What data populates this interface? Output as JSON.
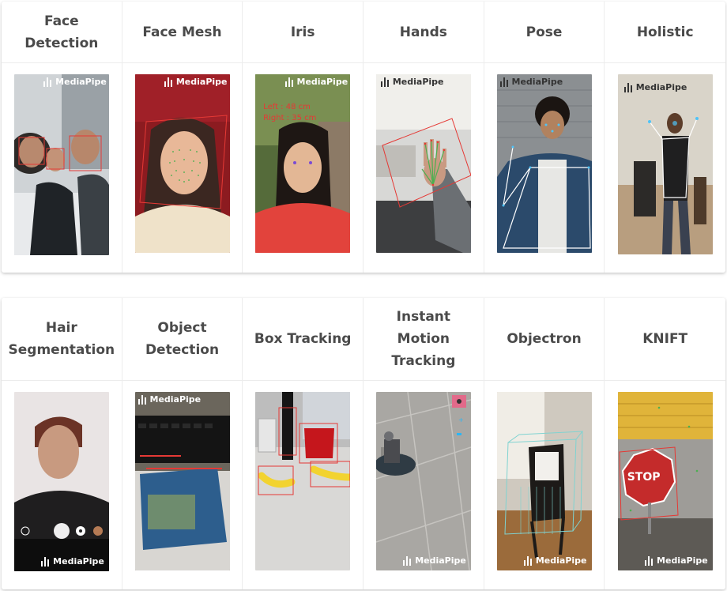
{
  "rows": [
    {
      "items": [
        {
          "key": "face_detection",
          "line1": "Face",
          "line2": "Detection"
        },
        {
          "key": "face_mesh",
          "line1": "Face Mesh",
          "line2": ""
        },
        {
          "key": "iris",
          "line1": "Iris",
          "line2": ""
        },
        {
          "key": "hands",
          "line1": "Hands",
          "line2": ""
        },
        {
          "key": "pose",
          "line1": "Pose",
          "line2": ""
        },
        {
          "key": "holistic",
          "line1": "Holistic",
          "line2": ""
        }
      ]
    },
    {
      "items": [
        {
          "key": "hair_segmentation",
          "line1": "Hair",
          "line2": "Segmentation"
        },
        {
          "key": "object_detection",
          "line1": "Object",
          "line2": "Detection"
        },
        {
          "key": "box_tracking",
          "line1": "Box Tracking",
          "line2": ""
        },
        {
          "key": "instant_motion_tracking",
          "line1": "Instant",
          "line2": "Motion",
          "line3": "Tracking"
        },
        {
          "key": "objectron",
          "line1": "Objectron",
          "line2": ""
        },
        {
          "key": "knift",
          "line1": "KNIFT",
          "line2": ""
        }
      ]
    }
  ],
  "watermark": "MediaPipe",
  "overlays": {
    "iris_left": "Left : 48 cm",
    "iris_right": "Right : 35 cm",
    "stop_sign": "STOP"
  },
  "colors": {
    "heading": "#4a4a4a",
    "detection_box": "#e53935",
    "landmark": "#4caf50",
    "pose_line": "#ffffff",
    "objectron_box": "#7fd3d1"
  }
}
